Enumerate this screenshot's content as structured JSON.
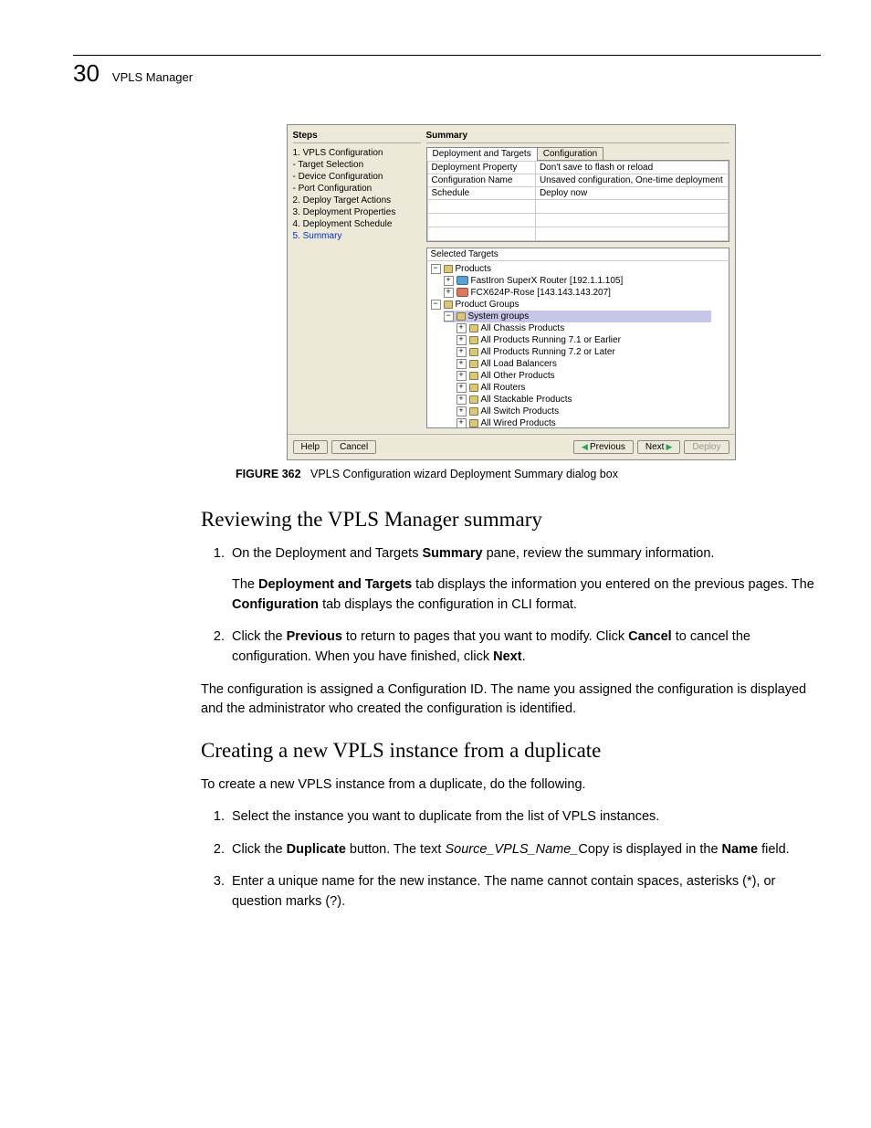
{
  "header": {
    "page_number": "30",
    "title": "VPLS Manager"
  },
  "shot": {
    "steps_title": "Steps",
    "steps": [
      {
        "label": "1. VPLS Configuration",
        "sub": false,
        "link": false
      },
      {
        "label": "- Target Selection",
        "sub": true,
        "link": false
      },
      {
        "label": "- Device Configuration",
        "sub": true,
        "link": false
      },
      {
        "label": "- Port Configuration",
        "sub": true,
        "link": false
      },
      {
        "label": "2. Deploy Target Actions",
        "sub": false,
        "link": false
      },
      {
        "label": "3. Deployment Properties",
        "sub": false,
        "link": false
      },
      {
        "label": "4. Deployment Schedule",
        "sub": false,
        "link": false
      },
      {
        "label": "5. Summary",
        "sub": false,
        "link": true
      }
    ],
    "summary_title": "Summary",
    "tabs": {
      "active": "Deployment and Targets",
      "other": "Configuration"
    },
    "props": [
      {
        "k": "Deployment Property",
        "v": "Don't save to flash or reload"
      },
      {
        "k": "Configuration Name",
        "v": "Unsaved configuration, One-time deployment"
      },
      {
        "k": "Schedule",
        "v": "Deploy now"
      }
    ],
    "sel_targets_title": "Selected Targets",
    "tree": {
      "products": "Products",
      "p1": "FastIron SuperX Router [192.1.1.105]",
      "p2": "FCX624P-Rose [143.143.143.207]",
      "product_groups": "Product Groups",
      "system_groups": "System groups",
      "items": [
        "All Chassis Products",
        "All Products Running 7.1 or Earlier",
        "All Products Running 7.2 or Later",
        "All Load Balancers",
        "All Other Products",
        "All Routers",
        "All Stackable Products",
        "All Switch Products",
        "All Wired Products"
      ]
    },
    "buttons": {
      "help": "Help",
      "cancel": "Cancel",
      "previous": "Previous",
      "next": "Next",
      "deploy": "Deploy"
    }
  },
  "figure": {
    "num": "FIGURE 362",
    "caption": "VPLS Configuration wizard Deployment Summary dialog box"
  },
  "sec1": {
    "title": "Reviewing the VPLS Manager summary",
    "li1_a": "On the Deployment and Targets ",
    "li1_b": "Summary",
    "li1_c": " pane, review the summary information.",
    "li1_p_a": "The ",
    "li1_p_b": "Deployment and Targets",
    "li1_p_c": " tab displays the information you entered on the previous pages. The ",
    "li1_p_d": "Configuration",
    "li1_p_e": " tab displays the configuration in CLI format.",
    "li2_a": "Click the ",
    "li2_b": "Previous",
    "li2_c": " to return to pages that you want to modify. Click ",
    "li2_d": "Cancel",
    "li2_e": " to cancel the configuration. When you have finished, click ",
    "li2_f": "Next",
    "li2_g": ".",
    "after": "The configuration is assigned a Configuration ID. The name you assigned the configuration is displayed and the administrator who created the configuration is identified."
  },
  "sec2": {
    "title": "Creating a new VPLS instance from a duplicate",
    "intro": "To create a new VPLS instance from a duplicate, do the following.",
    "li1": "Select the instance you want to duplicate from the list of VPLS instances.",
    "li2_a": "Click the ",
    "li2_b": "Duplicate",
    "li2_c": " button. The text ",
    "li2_d": "Source_VPLS_Name_",
    "li2_e": "Copy is displayed in the ",
    "li2_f": "Name",
    "li2_g": " field.",
    "li3": "Enter a unique name for the new instance. The name cannot contain spaces, asterisks (*), or question marks (?)."
  }
}
